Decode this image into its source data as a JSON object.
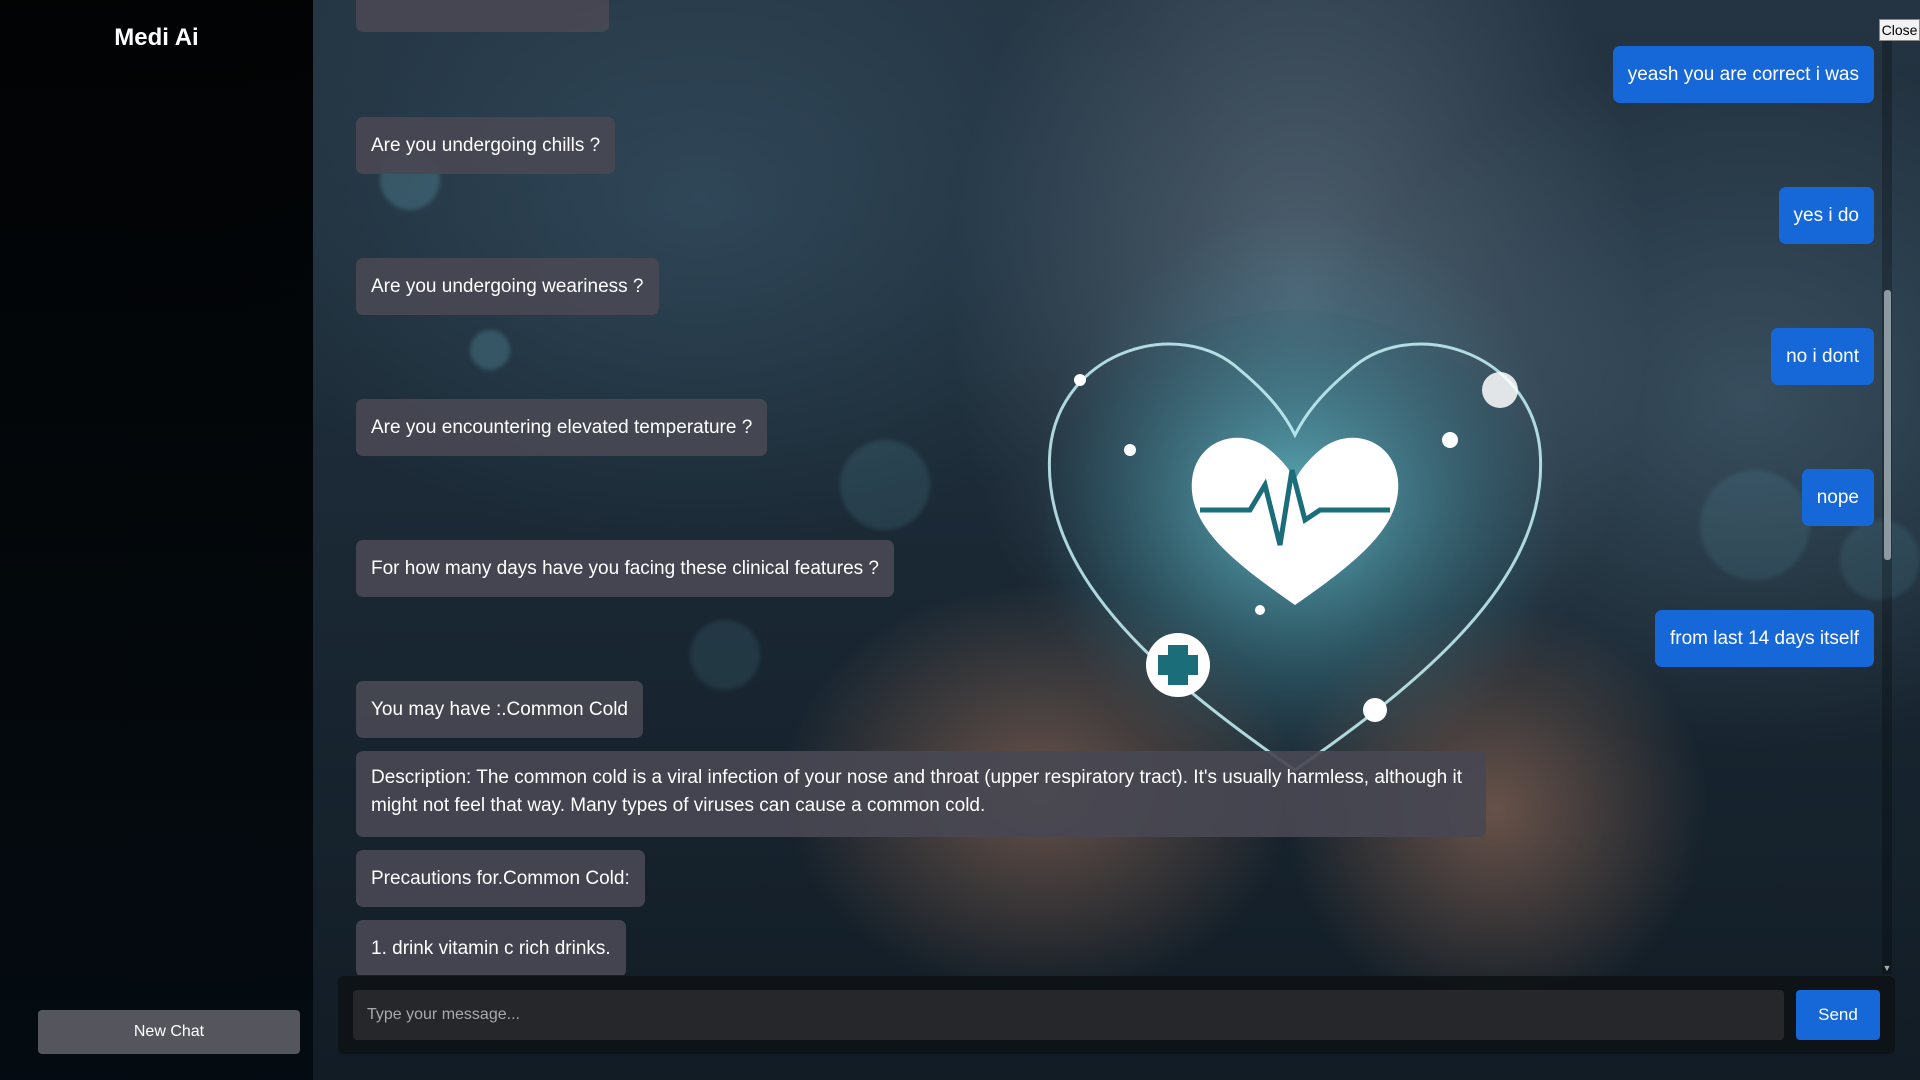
{
  "sidebar": {
    "brand": "Medi Ai",
    "new_chat_label": "New Chat"
  },
  "chat": {
    "bot_messages": [
      "Are you undergoing chills ?",
      "Are you undergoing weariness ?",
      "Are you encountering elevated temperature ?",
      "For how many days have you facing these clinical features ?",
      "You may have :.Common Cold",
      "Description: The common cold is a viral infection of your nose and throat (upper respiratory tract). It's usually harmless, although it might not feel that way. Many types of viruses can cause a common cold.",
      "Precautions for.Common Cold:",
      "1. drink vitamin c rich drinks."
    ],
    "user_messages": [
      "yeash you are correct i was",
      "yes i do",
      "no i dont",
      "nope",
      "from last 14 days itself"
    ]
  },
  "close_label": "Close",
  "composer": {
    "placeholder": "Type your message...",
    "send_label": "Send"
  },
  "colors": {
    "user_bubble": "#1667d8",
    "bot_bubble": "#484852",
    "sidebar": "#000000",
    "new_chat_button": "#55555e"
  }
}
